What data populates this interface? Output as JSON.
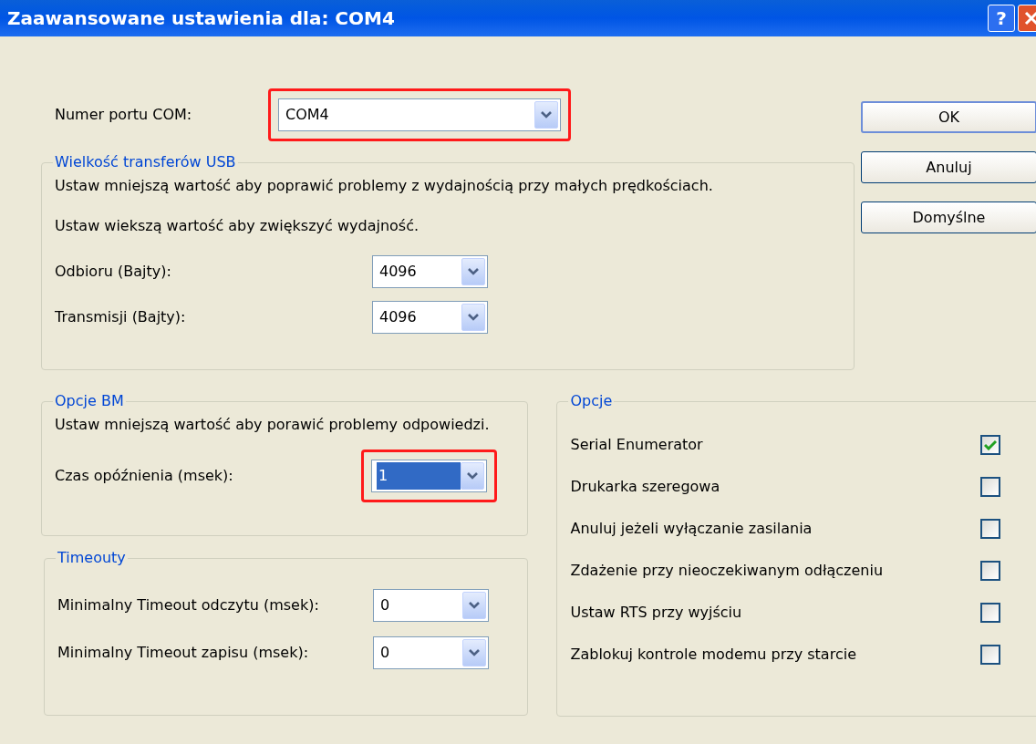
{
  "window": {
    "title": "Zaawansowane ustawienia dla: COM4",
    "help": "?"
  },
  "port": {
    "label": "Numer portu COM:",
    "value": "COM4",
    "selected": false,
    "highlighted": true
  },
  "usb_group": {
    "title": "Wielkość transferów USB",
    "notes": [
      "Ustaw mniejszą wartość aby poprawić problemy z wydajnością przy małych prędkościach.",
      "Ustaw wiekszą wartość aby zwiększyć wydajność."
    ],
    "fields": [
      {
        "label": "Odbioru (Bajty):",
        "value": "4096",
        "selected": false,
        "highlighted": false
      },
      {
        "label": "Transmisji (Bajty):",
        "value": "4096",
        "selected": false,
        "highlighted": false
      }
    ]
  },
  "bm_group": {
    "title": "Opcje BM",
    "note": "Ustaw mniejszą wartość aby porawić problemy odpowiedzi.",
    "fields": [
      {
        "label": "Czas opóźnienia (msek):",
        "value": "1",
        "selected": true,
        "highlighted": true
      }
    ]
  },
  "timeouts_group": {
    "title": "Timeouty",
    "fields": [
      {
        "label": "Minimalny Timeout odczytu (msek):",
        "value": "0",
        "selected": false,
        "highlighted": false
      },
      {
        "label": "Minimalny Timeout zapisu (msek):",
        "value": "0",
        "selected": false,
        "highlighted": false
      }
    ]
  },
  "options_group": {
    "title": "Opcje",
    "items": [
      {
        "label": "Serial Enumerator",
        "checked": true
      },
      {
        "label": "Drukarka szeregowa",
        "checked": false
      },
      {
        "label": "Anuluj jeżeli wyłączanie zasilania",
        "checked": false
      },
      {
        "label": "Zdażenie przy nieoczekiwanym odłączeniu",
        "checked": false
      },
      {
        "label": "Ustaw RTS przy wyjściu",
        "checked": false
      },
      {
        "label": "Zablokuj kontrole modemu przy starcie",
        "checked": false
      }
    ]
  },
  "buttons": [
    {
      "label": "OK",
      "default": true
    },
    {
      "label": "Anuluj",
      "default": false
    },
    {
      "label": "Domyślne",
      "default": false
    }
  ]
}
